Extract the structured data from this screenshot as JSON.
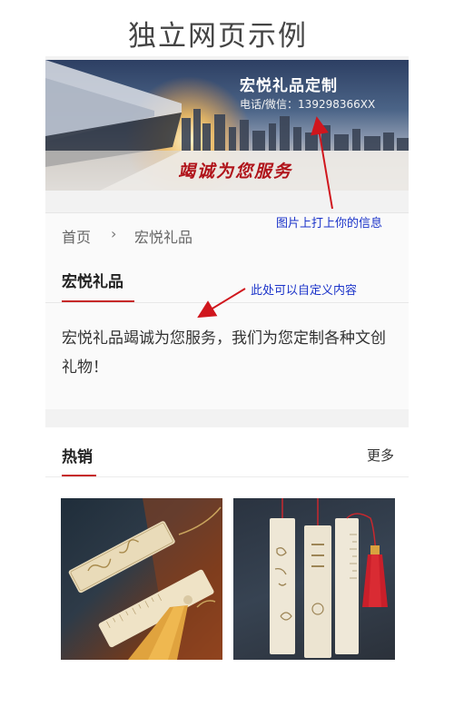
{
  "caption": "独立网页示例",
  "banner": {
    "title": "宏悦礼品定制",
    "phone": "电话/微信：139298366XX",
    "slogan": "竭诚为您服务"
  },
  "breadcrumb": {
    "home": "首页",
    "separator": "›",
    "current": "宏悦礼品"
  },
  "intro": {
    "title": "宏悦礼品",
    "text": "宏悦礼品竭诚为您服务，我们为您定制各种文创礼物！"
  },
  "hot": {
    "title": "热销",
    "more": "更多",
    "products": [
      {
        "name": "bookmark-product-1"
      },
      {
        "name": "bookmark-product-2"
      }
    ]
  },
  "annotations": {
    "note_banner": "图片上打上你的信息",
    "note_content": "此处可以自定义内容"
  },
  "colors": {
    "accent": "#c62828",
    "annotation": "#1b33c9",
    "slogan": "#b0131a"
  }
}
